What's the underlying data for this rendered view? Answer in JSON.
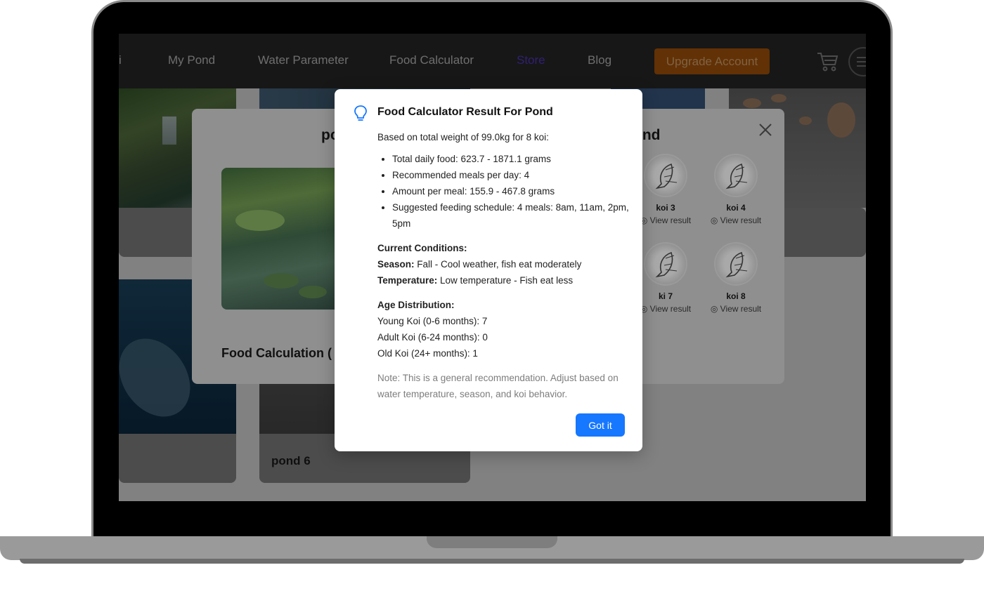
{
  "nav": {
    "partial_item": "i",
    "items": [
      "My Pond",
      "Water Parameter",
      "Food Calculator",
      "Store",
      "Blog"
    ],
    "upgrade_label": "Upgrade Account"
  },
  "background": {
    "pond6_label": "pond 6"
  },
  "pond_modal": {
    "title_partial_left": "po",
    "title_partial_right": "ond",
    "food_calc_partial": "Food Calculation (",
    "koi": [
      {
        "name": "koi 3",
        "view": "View result"
      },
      {
        "name": "koi 4",
        "view": "View result"
      },
      {
        "name": "ki 7",
        "view": "View result"
      },
      {
        "name": "koi 8",
        "view": "View result"
      }
    ]
  },
  "result_modal": {
    "title": "Food Calculator Result For Pond",
    "intro": "Based on total weight of 99.0kg for 8 koi:",
    "bullets": [
      "Total daily food: 623.7 - 1871.1 grams",
      "Recommended meals per day: 4",
      "Amount per meal: 155.9 - 467.8 grams",
      "Suggested feeding schedule: 4 meals: 8am, 11am, 2pm, 5pm"
    ],
    "conditions_heading": "Current Conditions:",
    "season_label": "Season:",
    "season_value": " Fall - Cool weather, fish eat moderately",
    "temperature_label": "Temperature:",
    "temperature_value": " Low temperature - Fish eat less",
    "age_heading": "Age Distribution:",
    "age_young": "Young Koi (0-6 months): 7",
    "age_adult": "Adult Koi (6-24 months): 0",
    "age_old": "Old Koi (24+ months): 1",
    "note": "Note: This is a general recommendation. Adjust based on water temperature, season, and koi behavior.",
    "button_label": "Got it"
  },
  "colors": {
    "primary_button": "#1677ff",
    "upgrade_button": "#b25a0a",
    "store_link": "#5a3bd0"
  }
}
